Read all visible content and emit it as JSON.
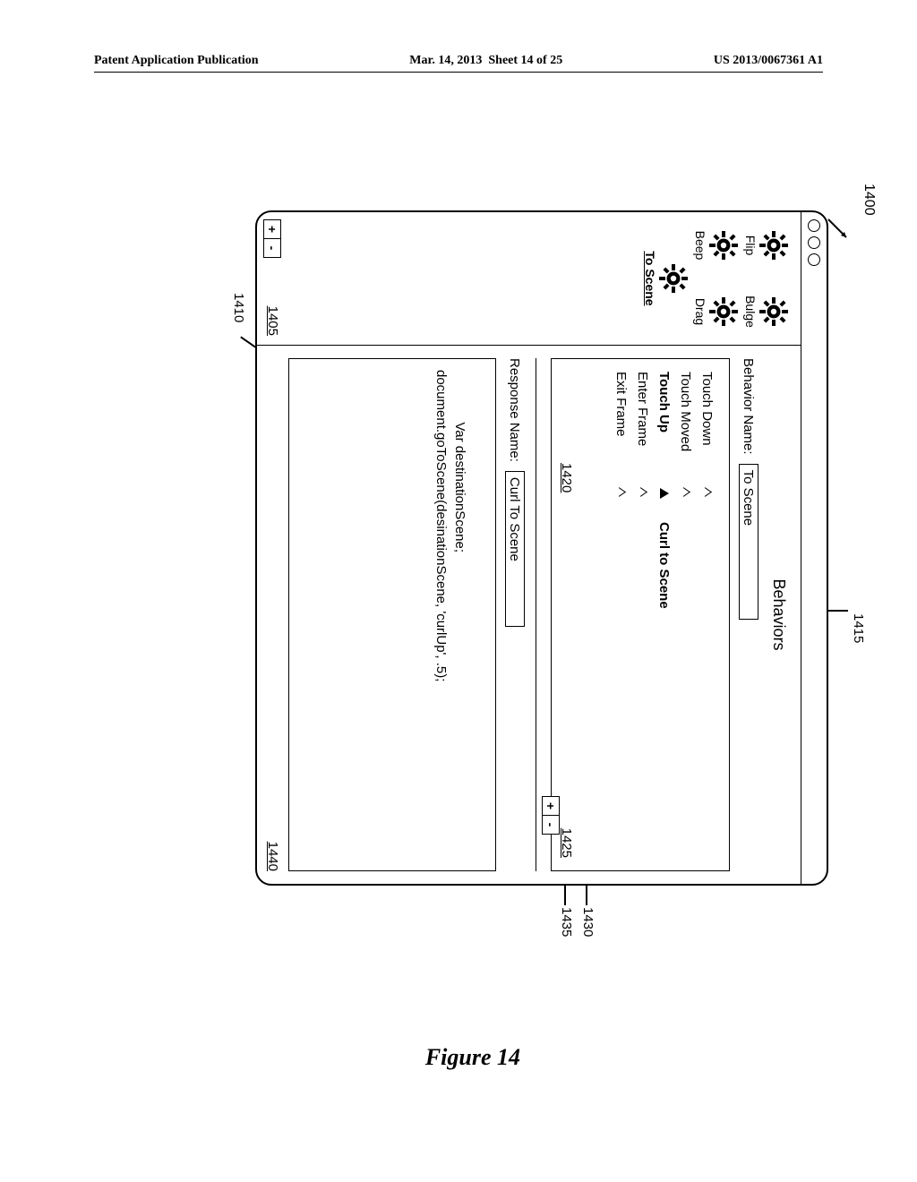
{
  "header": {
    "left": "Patent Application Publication",
    "mid": "Mar. 14, 2013  Sheet 14 of 25",
    "right": "US 2013/0067361 A1"
  },
  "figure_label": "Figure 14",
  "callout_1400": "1400",
  "window": {
    "title": "Behaviors",
    "behavior_label": "Behavior Name:",
    "behavior_value": "To Scene",
    "events": {
      "rows": [
        {
          "label": "Touch Down",
          "filled": false,
          "response": ""
        },
        {
          "label": "Touch Moved",
          "filled": false,
          "response": ""
        },
        {
          "label": "Touch Up",
          "filled": true,
          "response": "Curl to Scene"
        },
        {
          "label": "Enter Frame",
          "filled": false,
          "response": ""
        },
        {
          "label": "Exit Frame",
          "filled": false,
          "response": ""
        }
      ]
    },
    "response_label": "Response Name:",
    "response_value": "Curl To Scene",
    "code": "Var destinationScene;\ndocument.goToScene(desinationScene, 'curlUp', .5);",
    "plus": "+",
    "minus": "-"
  },
  "sidebar": {
    "items": [
      {
        "label": "Flip"
      },
      {
        "label": "Bulge"
      },
      {
        "label": "Beep"
      },
      {
        "label": "Drag"
      },
      {
        "label": "To Scene",
        "selected": true
      }
    ],
    "plus": "+",
    "minus": "-"
  },
  "refs": {
    "r1405": "1405",
    "r1410": "1410",
    "r1415": "1415",
    "r1420": "1420",
    "r1425": "1425",
    "r1430": "1430",
    "r1435": "1435",
    "r1440": "1440"
  }
}
